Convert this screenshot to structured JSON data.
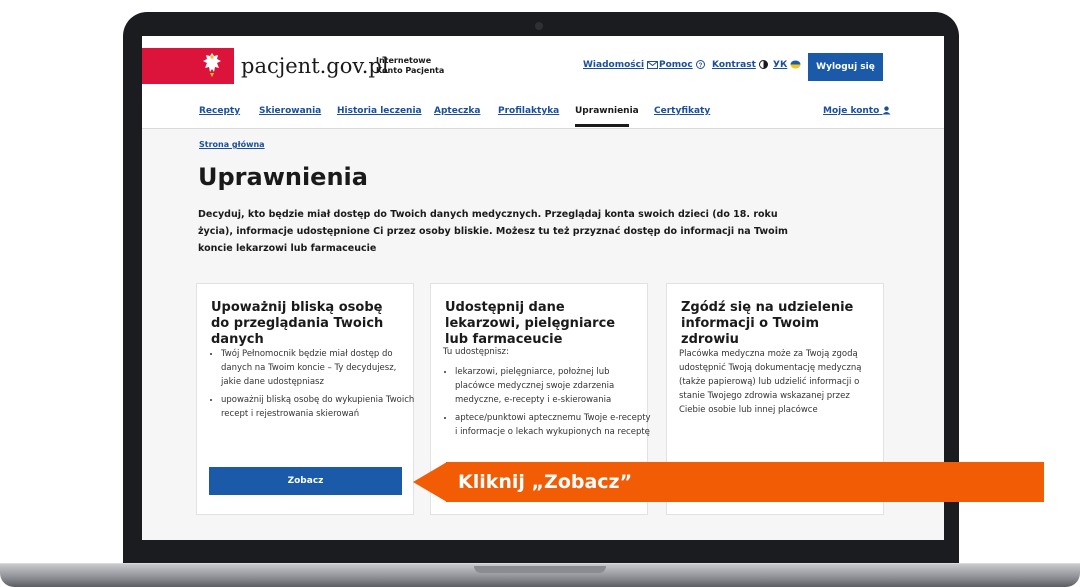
{
  "header": {
    "logo_text": "pacjent.gov.pl",
    "logo_sub": "Internetowe Konto Pacjenta",
    "links": [
      {
        "label": "Wiadomości",
        "icon": "mail-icon"
      },
      {
        "label": "Pomoc",
        "icon": "help-icon"
      },
      {
        "label": "Kontrast",
        "icon": "contrast-icon"
      },
      {
        "label": "УК",
        "icon": "ukraine-flag-icon"
      }
    ],
    "logout_label": "Wyloguj się"
  },
  "nav": {
    "items": [
      "Recepty",
      "Skierowania",
      "Historia leczenia",
      "Apteczka",
      "Profilaktyka",
      "Uprawnienia",
      "Certyfikaty"
    ],
    "active": "Uprawnienia",
    "account_label": "Moje konto"
  },
  "breadcrumb": "Strona główna",
  "page": {
    "title": "Uprawnienia",
    "description": "Decyduj, kto będzie miał dostęp do Twoich danych medycznych. Przeglądaj konta swoich dzieci (do 18. roku życia), informacje udostępnione Ci przez osoby bliskie. Możesz tu też przyznać dostęp do informacji na Twoim koncie lekarzowi lub farmaceucie"
  },
  "cards": [
    {
      "title": "Upoważnij bliską osobę do przeglądania Twoich danych",
      "bullets": [
        "Twój Pełnomocnik będzie miał dostęp do danych na Twoim koncie – Ty decydujesz, jakie dane udostępniasz",
        "upoważnij bliską osobę do wykupienia Twoich recept i rejestrowania skierowań"
      ],
      "button": "Zobacz"
    },
    {
      "title": "Udostępnij dane lekarzowi, pielęgniarce lub farmaceucie",
      "lead": "Tu udostępnisz:",
      "bullets": [
        "lekarzowi, pielęgniarce, położnej lub placówce medycznej swoje zdarzenia medyczne, e-recepty i e-skierowania",
        "aptece/punktowi aptecznemu Twoje e-recepty i informacje o lekach wykupionych na receptę"
      ]
    },
    {
      "title": "Zgódź się na udzielenie informacji o Twoim zdrowiu",
      "text": "Placówka medyczna może za Twoją zgodą udostępnić Twoją dokumentację medyczną (także papierową) lub udzielić informacji o stanie Twojego zdrowia wskazanej przez Ciebie osobie lub innej placówce"
    }
  ],
  "callout": "Kliknij „Zobacz”",
  "colors": {
    "accent": "#1b5aa8",
    "link": "#1b4f9c",
    "brand_red": "#dc143c",
    "callout": "#f25c05"
  }
}
